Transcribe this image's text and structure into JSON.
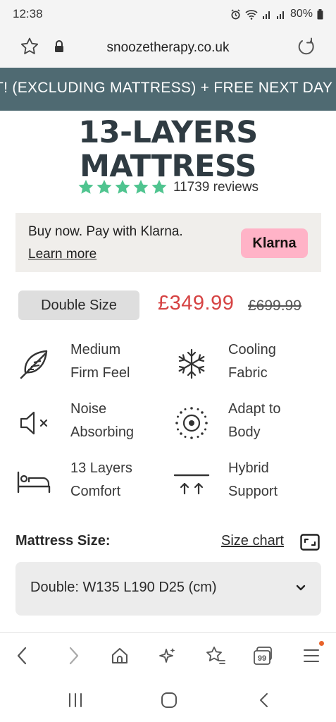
{
  "status_bar": {
    "time": "12:38",
    "battery": "80%",
    "icons": [
      "alarm-icon",
      "wifi-icon",
      "signal-icon",
      "signal-icon",
      "battery-icon"
    ]
  },
  "browser": {
    "url": "snoozetherapy.co.uk",
    "icons": [
      "star-icon",
      "lock-icon",
      "reload-icon"
    ]
  },
  "promo": {
    "text": "T! (EXCLUDING MATTRESS) + FREE NEXT DAY D",
    "background": "#4f6a72"
  },
  "product": {
    "title_line1": "13-LAYERS",
    "title_line2": "MATTRESS",
    "rating_stars": 5,
    "reviews": "11739 reviews",
    "star_color": "#4fc48f"
  },
  "klarna": {
    "text": "Buy now. Pay with Klarna.",
    "link": "Learn more",
    "badge": "Klarna",
    "badge_color": "#ffb3c7"
  },
  "pricing": {
    "size_label": "Double Size",
    "price": "£349.99",
    "old_price": "£699.99",
    "price_color": "#d64343"
  },
  "features": [
    {
      "line1": "Medium",
      "line2": "Firm Feel",
      "icon": "feather-icon"
    },
    {
      "line1": "Cooling",
      "line2": "Fabric",
      "icon": "snowflake-icon"
    },
    {
      "line1": "Noise",
      "line2": "Absorbing",
      "icon": "speaker-mute-icon"
    },
    {
      "line1": "Adapt to",
      "line2": "Body",
      "icon": "target-icon"
    },
    {
      "line1": "13 Layers",
      "line2": "Comfort",
      "icon": "bed-icon"
    },
    {
      "line1": "Hybrid",
      "line2": "Support",
      "icon": "arrows-up-icon"
    }
  ],
  "mattress_size": {
    "label": "Mattress Size:",
    "size_chart": "Size chart",
    "selected": "Double: W135 L190 D25 (cm)"
  },
  "bottom_nav": {
    "icons": [
      "back-icon",
      "forward-icon",
      "home-icon",
      "sparkle-icon",
      "bookmarks-icon",
      "tabs-icon",
      "menu-icon"
    ],
    "tabs_count": "99"
  },
  "system_nav": {
    "icons": [
      "recents-icon",
      "home-circle-icon",
      "back-chevron-icon"
    ]
  }
}
